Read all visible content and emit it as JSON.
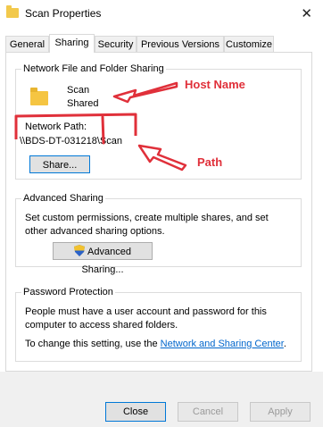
{
  "window": {
    "title": "Scan Properties",
    "close_glyph": "✕"
  },
  "tabs": [
    {
      "label": "General"
    },
    {
      "label": "Sharing"
    },
    {
      "label": "Security"
    },
    {
      "label": "Previous Versions"
    },
    {
      "label": "Customize"
    }
  ],
  "network_sharing": {
    "title": "Network File and Folder Sharing",
    "folder_name": "Scan",
    "folder_status": "Shared",
    "path_label": "Network Path:",
    "path_value": "\\\\BDS-DT-031218\\Scan",
    "share_button": "Share..."
  },
  "advanced_sharing": {
    "title": "Advanced Sharing",
    "description": "Set custom permissions, create multiple shares, and set other advanced sharing options.",
    "button": "Advanced Sharing..."
  },
  "password_protection": {
    "title": "Password Protection",
    "description": "People must have a user account and password for this computer to access shared folders.",
    "change_prefix": "To change this setting, use the ",
    "link": "Network and Sharing Center",
    "change_suffix": "."
  },
  "buttons": {
    "close": "Close",
    "cancel": "Cancel",
    "apply": "Apply"
  },
  "annotations": {
    "host_name": "Host Name",
    "path": "Path",
    "color": "#e0303a"
  }
}
